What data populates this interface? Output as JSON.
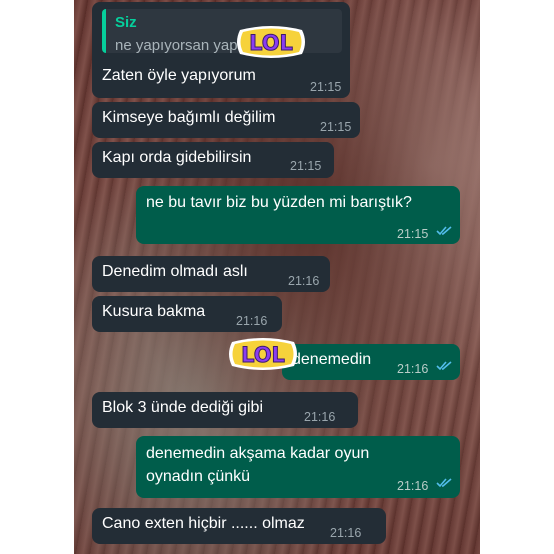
{
  "messages": [
    {
      "type": "incoming",
      "quote_name": "Siz",
      "quote_text": "ne yapıyorsan yap",
      "text": "Zaten öyle yapıyorum",
      "time": "21:15"
    },
    {
      "type": "incoming",
      "text": "Kimseye bağımlı değilim",
      "time": "21:15"
    },
    {
      "type": "incoming",
      "text": "Kapı orda gidebilirsin",
      "time": "21:15"
    },
    {
      "type": "outgoing",
      "text": "ne bu tavır biz bu yüzden mi barıştık?",
      "time": "21:15",
      "status": "read"
    },
    {
      "type": "incoming",
      "text": "Denedim olmadı aslı",
      "time": "21:16"
    },
    {
      "type": "incoming",
      "text": "Kusura bakma",
      "time": "21:16"
    },
    {
      "type": "outgoing",
      "text": "denemedin",
      "time": "21:16",
      "status": "read"
    },
    {
      "type": "incoming",
      "text": "Blok 3 ünde dediği gibi",
      "time": "21:16"
    },
    {
      "type": "outgoing",
      "text": "denemedin akşama kadar oyun oynadın çünkü",
      "text_line1": "denemedin akşama kadar oyun",
      "text_line2": "oynadın çünkü",
      "time": "21:16",
      "status": "read"
    },
    {
      "type": "incoming",
      "text": "Cano exten hiçbir ...... olmaz",
      "time": "21:16"
    }
  ],
  "stickers": [
    {
      "text": "LOL",
      "fill": "#8a3df0",
      "stroke": "#f6d23b"
    },
    {
      "text": "LOL",
      "fill": "#8a3df0",
      "stroke": "#f6d23b"
    }
  ],
  "colors": {
    "incoming_bubble": "#232d36",
    "outgoing_bubble": "#005d4b",
    "quote_accent": "#06cf9c",
    "read_tick": "#53bdeb"
  }
}
